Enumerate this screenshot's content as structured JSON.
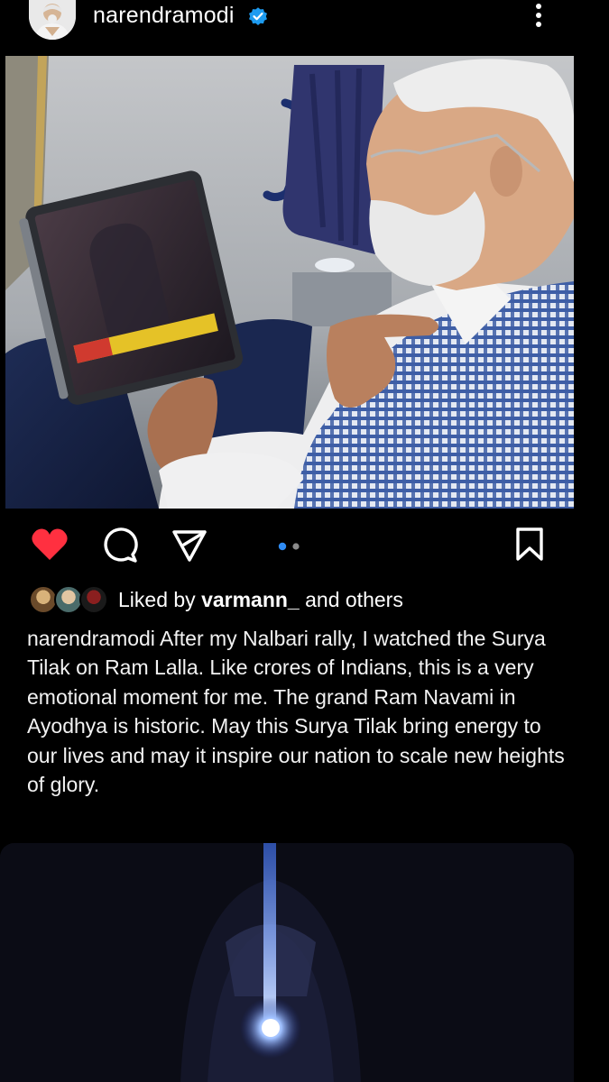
{
  "post": {
    "username": "narendramodi",
    "liked_by_prefix": "Liked by ",
    "liked_by_user": "varmann_",
    "liked_by_suffix": " and others",
    "caption_user": "narendramodi",
    "caption_text": " After my Nalbari rally, I watched the Surya Tilak on Ram Lalla. Like crores of Indians, this is a very emotional moment for me. The grand Ram Navami in Ayodhya is historic. May this Surya Tilak bring energy to our lives and may it inspire our nation to scale new heights of glory.",
    "carousel": {
      "total": 2,
      "current": 1
    },
    "liked": true
  },
  "icons": {
    "verified": "verified-badge-icon",
    "more": "more-options-icon",
    "like": "heart-icon",
    "comment": "comment-icon",
    "share": "share-icon",
    "save": "bookmark-icon"
  },
  "colors": {
    "background": "#000000",
    "like_red": "#ff3040",
    "verified_blue": "#1d9bf0",
    "carousel_active": "#2f8cf5",
    "carousel_inactive": "#8a8a8a"
  }
}
